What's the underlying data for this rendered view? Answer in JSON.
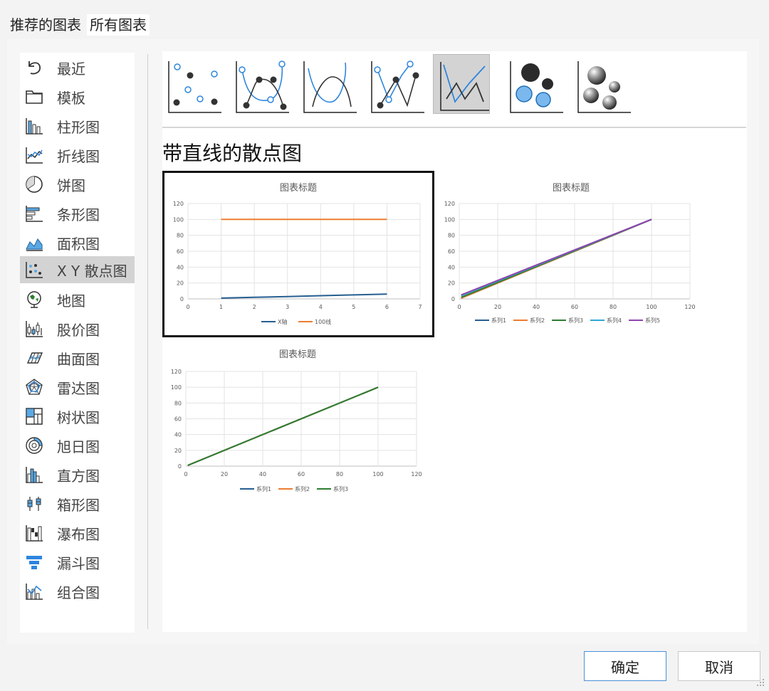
{
  "tabs": {
    "recommended": "推荐的图表",
    "all": "所有图表"
  },
  "sidebar": {
    "items": [
      {
        "label": "最近",
        "icon": "undo-icon"
      },
      {
        "label": "模板",
        "icon": "folder-icon"
      },
      {
        "label": "柱形图",
        "icon": "column-chart-icon"
      },
      {
        "label": "折线图",
        "icon": "line-chart-icon"
      },
      {
        "label": "饼图",
        "icon": "pie-chart-icon"
      },
      {
        "label": "条形图",
        "icon": "bar-chart-icon"
      },
      {
        "label": "面积图",
        "icon": "area-chart-icon"
      },
      {
        "label": "X Y 散点图",
        "icon": "scatter-chart-icon",
        "selected": true
      },
      {
        "label": "地图",
        "icon": "globe-icon"
      },
      {
        "label": "股价图",
        "icon": "stock-chart-icon"
      },
      {
        "label": "曲面图",
        "icon": "surface-chart-icon"
      },
      {
        "label": "雷达图",
        "icon": "radar-chart-icon"
      },
      {
        "label": "树状图",
        "icon": "treemap-icon"
      },
      {
        "label": "旭日图",
        "icon": "sunburst-icon"
      },
      {
        "label": "直方图",
        "icon": "histogram-icon"
      },
      {
        "label": "箱形图",
        "icon": "box-whisker-icon"
      },
      {
        "label": "瀑布图",
        "icon": "waterfall-icon"
      },
      {
        "label": "漏斗图",
        "icon": "funnel-icon"
      },
      {
        "label": "组合图",
        "icon": "combo-chart-icon"
      }
    ]
  },
  "subtypes": [
    {
      "icon": "scatter-icon"
    },
    {
      "icon": "scatter-smooth-lines-markers-icon"
    },
    {
      "icon": "scatter-smooth-lines-icon"
    },
    {
      "icon": "scatter-straight-lines-markers-icon"
    },
    {
      "icon": "scatter-straight-lines-icon",
      "selected": true
    },
    {
      "icon": "bubble-icon"
    },
    {
      "icon": "bubble-3d-icon"
    }
  ],
  "section_title": "带直线的散点图",
  "colors": {
    "blue": "#255e91",
    "orange": "#ed7d31",
    "green": "#2e7d32",
    "cyan": "#2ea8d6",
    "purple": "#8e44ad",
    "selected_bg": "#d3d3d3",
    "accent": "#4a90d9"
  },
  "chart_data": [
    {
      "type": "line",
      "title": "图表标题",
      "xlim": [
        0,
        7
      ],
      "ylim": [
        0,
        120
      ],
      "xticks": [
        "0",
        "1",
        "2",
        "3",
        "4",
        "5",
        "6",
        "7"
      ],
      "yticks": [
        "0",
        "20",
        "40",
        "60",
        "80",
        "100",
        "120"
      ],
      "grid": true,
      "legend": "bottom",
      "series": [
        {
          "name": "X轴",
          "color": "#255e91",
          "points": [
            [
              1,
              1
            ],
            [
              2,
              2
            ],
            [
              3,
              3
            ],
            [
              4,
              4
            ],
            [
              5,
              5
            ],
            [
              6,
              6
            ]
          ]
        },
        {
          "name": "100线",
          "color": "#ed7d31",
          "points": [
            [
              1,
              100
            ],
            [
              2,
              100
            ],
            [
              3,
              100
            ],
            [
              4,
              100
            ],
            [
              5,
              100
            ],
            [
              6,
              100
            ]
          ]
        }
      ]
    },
    {
      "type": "line",
      "title": "图表标题",
      "xlim": [
        0,
        120
      ],
      "ylim": [
        0,
        120
      ],
      "xticks": [
        "0",
        "20",
        "40",
        "60",
        "80",
        "100",
        "120"
      ],
      "yticks": [
        "0",
        "20",
        "40",
        "60",
        "80",
        "100",
        "120"
      ],
      "grid": true,
      "legend": "bottom",
      "series": [
        {
          "name": "系列1",
          "color": "#255e91",
          "points": [
            [
              1,
              1
            ],
            [
              100,
              100
            ]
          ]
        },
        {
          "name": "系列2",
          "color": "#ed7d31",
          "points": [
            [
              1,
              1
            ],
            [
              100,
              100
            ]
          ]
        },
        {
          "name": "系列3",
          "color": "#2e7d32",
          "points": [
            [
              1,
              2
            ],
            [
              100,
              100
            ]
          ]
        },
        {
          "name": "系列4",
          "color": "#2ea8d6",
          "points": [
            [
              1,
              4
            ],
            [
              100,
              100
            ]
          ]
        },
        {
          "name": "系列5",
          "color": "#8e44ad",
          "points": [
            [
              1,
              5
            ],
            [
              100,
              100
            ]
          ]
        }
      ]
    },
    {
      "type": "line",
      "title": "图表标题",
      "xlim": [
        0,
        120
      ],
      "ylim": [
        0,
        120
      ],
      "xticks": [
        "0",
        "20",
        "40",
        "60",
        "80",
        "100",
        "120"
      ],
      "yticks": [
        "0",
        "20",
        "40",
        "60",
        "80",
        "100",
        "120"
      ],
      "grid": true,
      "legend": "bottom",
      "series": [
        {
          "name": "系列1",
          "color": "#255e91",
          "points": [
            [
              1,
              1
            ],
            [
              100,
              100
            ]
          ]
        },
        {
          "name": "系列2",
          "color": "#ed7d31",
          "points": [
            [
              1,
              1
            ],
            [
              100,
              100
            ]
          ]
        },
        {
          "name": "系列3",
          "color": "#2e7d32",
          "points": [
            [
              1,
              1
            ],
            [
              100,
              100
            ]
          ]
        }
      ]
    }
  ],
  "buttons": {
    "ok": "确定",
    "cancel": "取消"
  }
}
